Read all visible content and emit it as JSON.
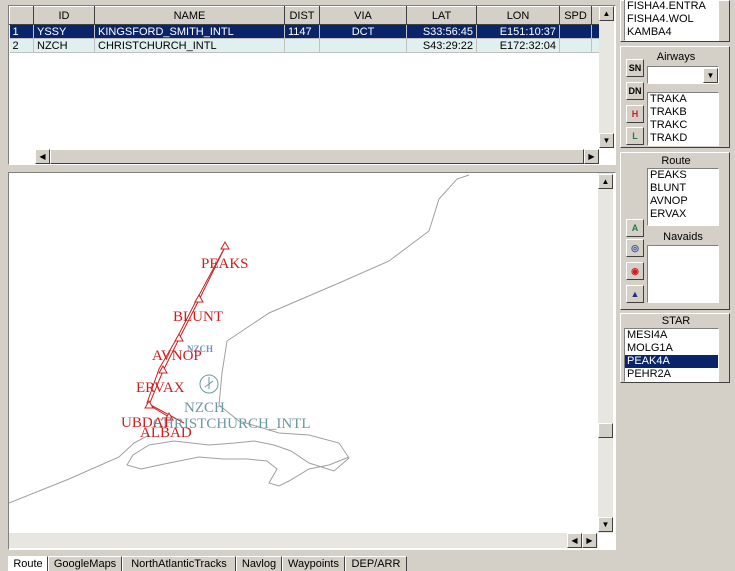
{
  "grid": {
    "columns": [
      "ID",
      "NAME",
      "DIST",
      "VIA",
      "LAT",
      "LON",
      "SPD"
    ],
    "rows": [
      {
        "num": "1",
        "id": "YSSY",
        "name": "KINGSFORD_SMITH_INTL",
        "dist": "1147",
        "via": "DCT",
        "lat": "S33:56:45",
        "lon": "E151:10:37",
        "spd": ""
      },
      {
        "num": "2",
        "id": "NZCH",
        "name": "CHRISTCHURCH_INTL",
        "dist": "",
        "via": "",
        "lat": "S43:29:22",
        "lon": "E172:32:04",
        "spd": ""
      }
    ]
  },
  "map": {
    "waypoints": [
      "PEAKS",
      "BLUNT",
      "AVNOP",
      "ERVAX",
      "UBDAT",
      "ALBAD"
    ],
    "airport_code": "NZCH",
    "airport_name": "CHRISTCHURCH_INTL",
    "faint_label": "NZCH"
  },
  "right": {
    "top_list": [
      "FISHA4.ENTRA",
      "FISHA4.WOL",
      "KAMBA4"
    ],
    "airways_label": "Airways",
    "airways_list": [
      "TRAKA",
      "TRAKB",
      "TRAKC",
      "TRAKD"
    ],
    "route_label": "Route",
    "route_list": [
      "PEAKS",
      "BLUNT",
      "AVNOP",
      "ERVAX"
    ],
    "navaids_label": "Navaids",
    "star_label": "STAR",
    "star_list": [
      "MESI4A",
      "MOLG1A",
      "PEAK4A",
      "PEHR2A"
    ],
    "star_selected": "PEAK4A",
    "buttons": {
      "sn": "SN",
      "dn": "DN",
      "h": "H",
      "l": "L",
      "a": "A"
    }
  },
  "tabs": [
    "Route",
    "GoogleMaps",
    "NorthAtlanticTracks",
    "Navlog",
    "Waypoints",
    "DEP/ARR"
  ],
  "colors": {
    "selection": "#0a246a",
    "route": "#cc2020",
    "airport": "#6a9aa0",
    "coast": "#a0a0a0",
    "alt_row": "#dff0ee"
  }
}
